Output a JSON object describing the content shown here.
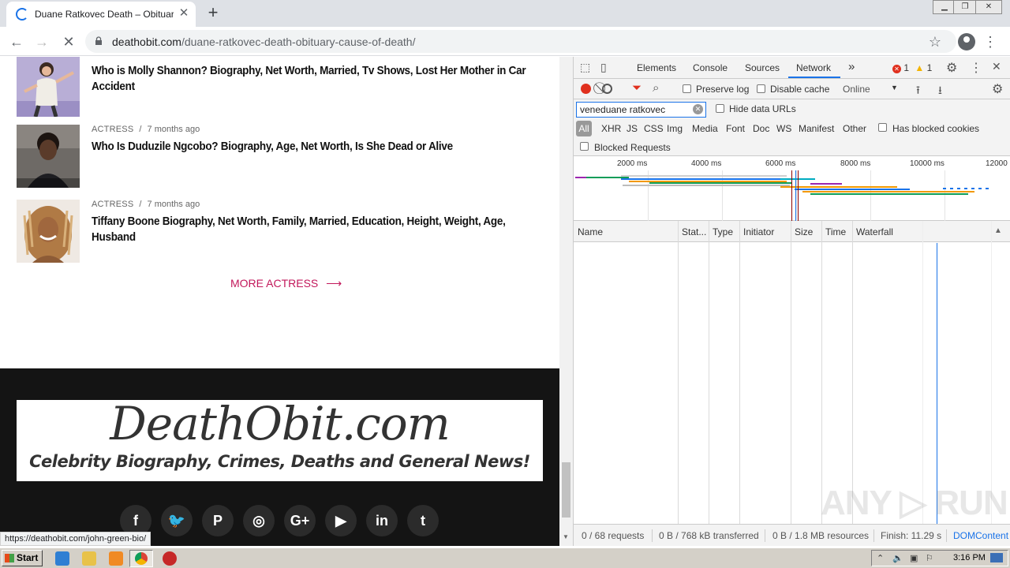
{
  "browser": {
    "tab_title": "Duane Ratkovec Death – Obituary, Cause of Death",
    "new_tab_symbol": "+",
    "url_host": "deathobit.com",
    "url_path": "/duane-ratkovec-death-obituary-cause-of-death/",
    "status_url": "https://deathobit.com/john-green-bio/"
  },
  "page": {
    "articles": [
      {
        "category": "",
        "time": "",
        "title": "Who is Molly Shannon? Biography, Net Worth, Married, Tv Shows, Lost Her Mother in Car Accident"
      },
      {
        "category": "ACTRESS",
        "time": "7 months ago",
        "title": "Who Is Duduzile Ngcobo? Biography, Age, Net Worth, Is She Dead or Alive"
      },
      {
        "category": "ACTRESS",
        "time": "7 months ago",
        "title": "Tiffany Boone Biography, Net Worth, Family, Married, Education, Height, Weight, Age, Husband"
      }
    ],
    "meta_separator": "/",
    "more_label": "MORE ACTRESS",
    "more_arrow": "⟶",
    "footer_logo": "DeathObit.com",
    "footer_tagline": "Celebrity Biography, Crimes, Deaths and General News!",
    "social": [
      {
        "icon": "facebook-icon",
        "glyph": "f"
      },
      {
        "icon": "twitter-icon",
        "glyph": "🐦"
      },
      {
        "icon": "pinterest-icon",
        "glyph": "P"
      },
      {
        "icon": "instagram-icon",
        "glyph": "◎"
      },
      {
        "icon": "google-plus-icon",
        "glyph": "G+"
      },
      {
        "icon": "youtube-icon",
        "glyph": "▶"
      },
      {
        "icon": "linkedin-icon",
        "glyph": "in"
      },
      {
        "icon": "tumblr-icon",
        "glyph": "t"
      }
    ]
  },
  "devtools": {
    "tabs": [
      "Elements",
      "Console",
      "Sources",
      "Network"
    ],
    "active_tab": "Network",
    "more_tabs": "»",
    "errors": "1",
    "warnings": "1",
    "toolbar": {
      "preserve_log": "Preserve log",
      "disable_cache": "Disable cache",
      "throttle": "Online"
    },
    "filter": {
      "value": "veneduane ratkovec",
      "hide_data_urls": "Hide data URLs",
      "types": [
        "All",
        "XHR",
        "JS",
        "CSS",
        "Img",
        "Media",
        "Font",
        "Doc",
        "WS",
        "Manifest",
        "Other"
      ],
      "has_blocked_cookies": "Has blocked cookies",
      "blocked_requests": "Blocked Requests"
    },
    "overview_ticks": [
      "2000 ms",
      "4000 ms",
      "6000 ms",
      "8000 ms",
      "10000 ms",
      "12000"
    ],
    "columns": [
      "Name",
      "Stat...",
      "Type",
      "Initiator",
      "Size",
      "Time",
      "Waterfall"
    ],
    "sort_arrow": "▲",
    "summary": {
      "requests": "0 / 68 requests",
      "transferred": "0 B / 768 kB transferred",
      "resources": "0 B / 1.8 MB resources",
      "finish": "Finish: 11.29 s",
      "domcontent": "DOMContent"
    }
  },
  "taskbar": {
    "start": "Start",
    "clock": "3:16 PM"
  },
  "watermark": "ANY ▷ RUN",
  "colors": {
    "accent_link": "#c2185b",
    "devtools_blue": "#1a73e8",
    "record_red": "#e0301e",
    "footer_bg": "#141414"
  }
}
